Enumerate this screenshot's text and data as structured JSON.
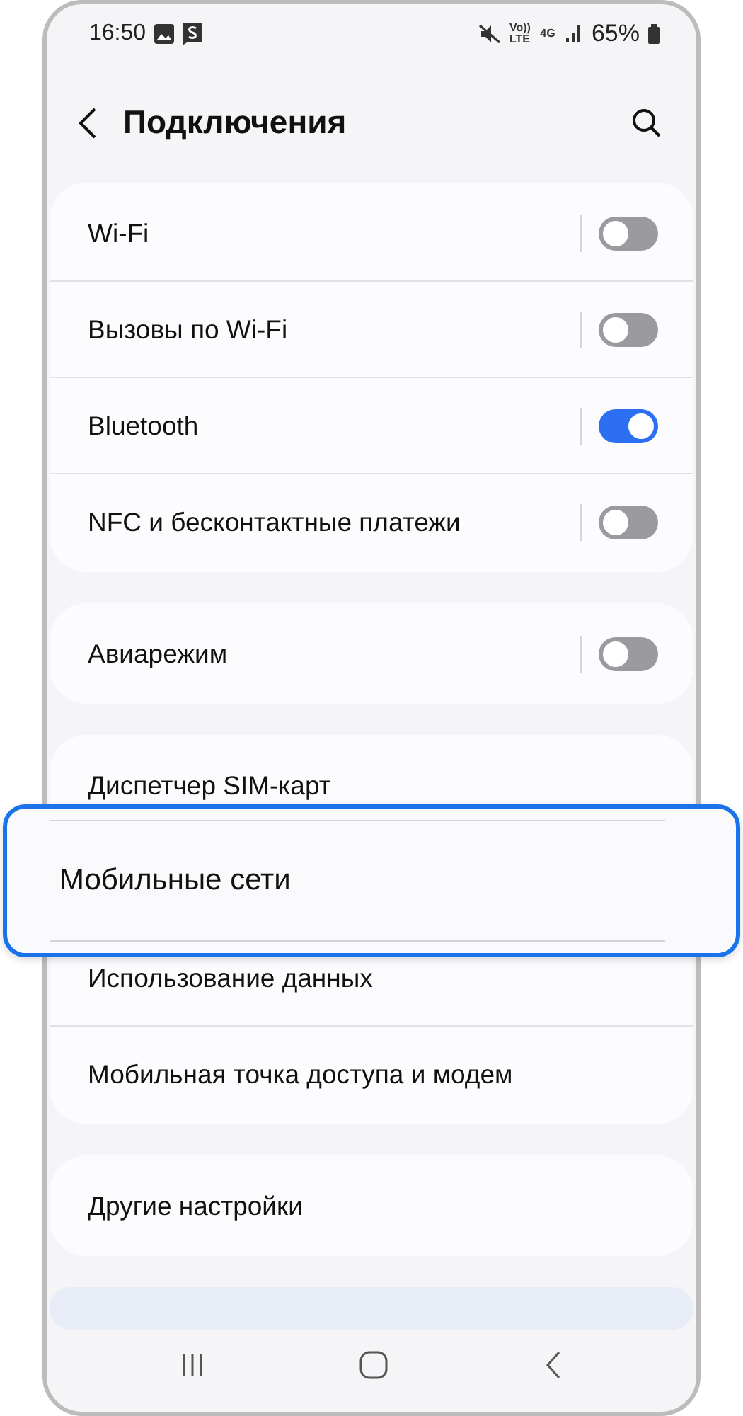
{
  "status_bar": {
    "time": "16:50",
    "volte": "Vo)) LTE",
    "network": "4G",
    "battery": "65%"
  },
  "header": {
    "title": "Подключения"
  },
  "groups": [
    {
      "rows": [
        {
          "label": "Wi-Fi",
          "kind": "toggle",
          "on": false
        },
        {
          "label": "Вызовы по Wi-Fi",
          "kind": "toggle",
          "on": false
        },
        {
          "label": "Bluetooth",
          "kind": "toggle",
          "on": true
        },
        {
          "label": "NFC и бесконтактные платежи",
          "kind": "toggle",
          "on": false
        }
      ]
    },
    {
      "rows": [
        {
          "label": "Авиарежим",
          "kind": "toggle",
          "on": false
        }
      ]
    },
    {
      "rows": [
        {
          "label": "Диспетчер SIM-карт",
          "kind": "link",
          "highlighted": false
        },
        {
          "label": "Мобильные сети",
          "kind": "link",
          "highlighted": true
        },
        {
          "label": "Использование данных",
          "kind": "link",
          "highlighted": false
        },
        {
          "label": "Мобильная точка доступа и модем",
          "kind": "link",
          "highlighted": false
        }
      ]
    },
    {
      "rows": [
        {
          "label": "Другие настройки",
          "kind": "link",
          "highlighted": false
        }
      ]
    }
  ]
}
